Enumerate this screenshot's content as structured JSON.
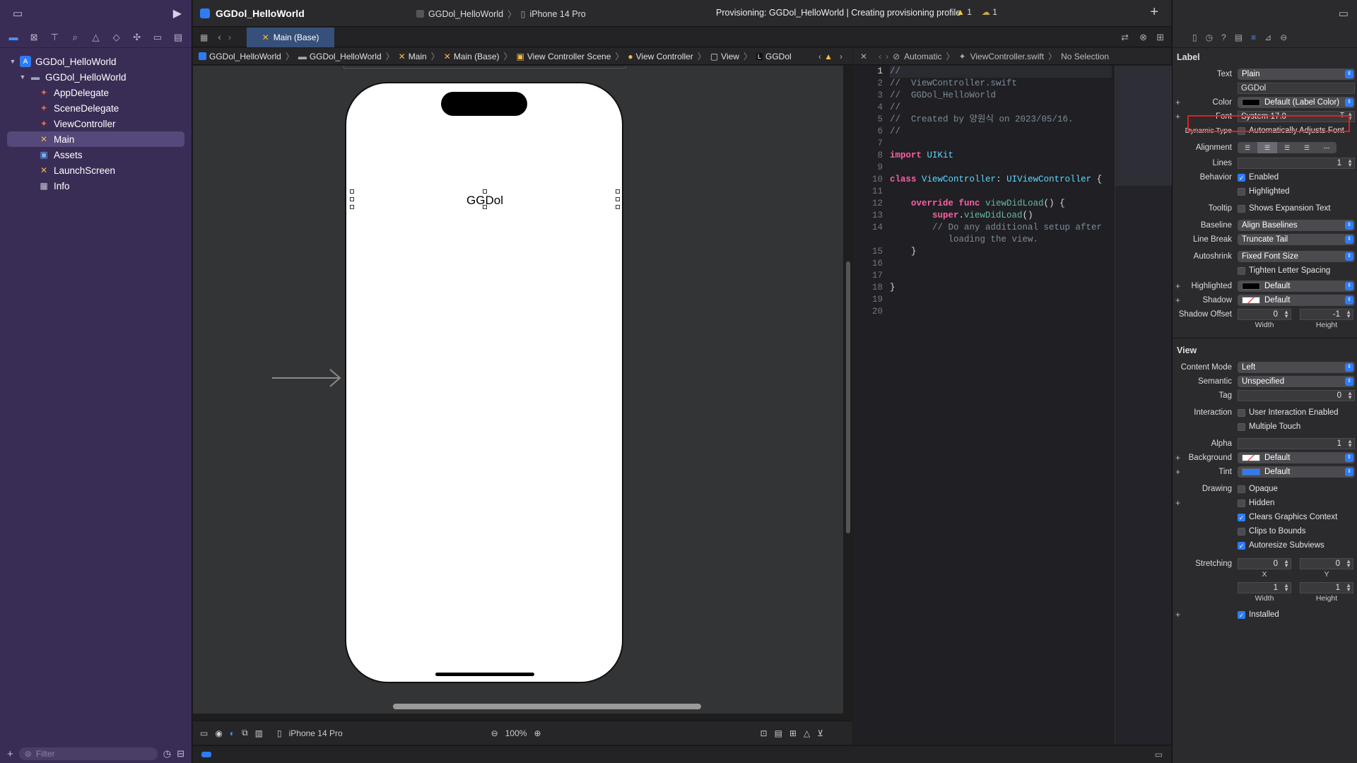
{
  "navigator": {
    "filter_placeholder": "Filter",
    "items": [
      {
        "label": "GGDol_HelloWorld",
        "level": 0,
        "icon": "app-project-icon"
      },
      {
        "label": "GGDol_HelloWorld",
        "level": 1,
        "icon": "folder-icon"
      },
      {
        "label": "AppDelegate",
        "level": 2,
        "icon": "swift-file-icon"
      },
      {
        "label": "SceneDelegate",
        "level": 2,
        "icon": "swift-file-icon"
      },
      {
        "label": "ViewController",
        "level": 2,
        "icon": "swift-file-icon"
      },
      {
        "label": "Main",
        "level": 2,
        "icon": "storyboard-icon"
      },
      {
        "label": "Assets",
        "level": 2,
        "icon": "assets-icon"
      },
      {
        "label": "LaunchScreen",
        "level": 2,
        "icon": "storyboard-icon"
      },
      {
        "label": "Info",
        "level": 2,
        "icon": "plist-icon"
      }
    ]
  },
  "toolbar": {
    "project_title": "GGDol_HelloWorld",
    "scheme": "GGDol_HelloWorld",
    "device": "iPhone 14 Pro",
    "status": "Provisioning: GGDol_HelloWorld | Creating provisioning profile",
    "warnings": "1",
    "issues": "1"
  },
  "tab": {
    "label": "Main (Base)"
  },
  "jumpbar": {
    "items": [
      "GGDol_HelloWorld",
      "GGDol_HelloWorld",
      "Main",
      "Main (Base)",
      "View Controller Scene",
      "View Controller",
      "View",
      "GGDol"
    ]
  },
  "jumpbar2": {
    "mode": "Automatic",
    "file": "ViewController.swift",
    "selection": "No Selection"
  },
  "canvas": {
    "label_text": "GGDol",
    "device": "iPhone 14 Pro",
    "zoom": "100%"
  },
  "code": {
    "line_numbers": [
      "1",
      "2",
      "3",
      "4",
      "5",
      "6",
      "7",
      "8",
      "9",
      "10",
      "11",
      "12",
      "13",
      "14",
      "",
      "15",
      "16",
      "17",
      "18",
      "19",
      "20"
    ],
    "lines": [
      "//",
      "//  ViewController.swift",
      "//  GGDol_HelloWorld",
      "//",
      "//  Created by 양원식 on 2023/05/16.",
      "//",
      "",
      "import UIKit",
      "",
      "class ViewController: UIViewController {",
      "",
      "    override func viewDidLoad() {",
      "        super.viewDidLoad()",
      "        // Do any additional setup after",
      "           loading the view.",
      "    }",
      "",
      "",
      "}",
      "",
      ""
    ]
  },
  "inspector": {
    "label_section": "Label",
    "text_label": "Text",
    "text_value": "Plain",
    "text_content": "GGDol",
    "color_label": "Color",
    "color_value": "Default (Label Color)",
    "font_label": "Font",
    "font_value": "System 17.0",
    "dynamic_label": "Dynamic Type",
    "dynamic_value": "Automatically Adjusts Font",
    "alignment_label": "Alignment",
    "lines_label": "Lines",
    "lines_value": "1",
    "behavior_label": "Behavior",
    "enabled": "Enabled",
    "highlighted": "Highlighted",
    "tooltip_label": "Tooltip",
    "tooltip_value": "Shows Expansion Text",
    "baseline_label": "Baseline",
    "baseline_value": "Align Baselines",
    "linebreak_label": "Line Break",
    "linebreak_value": "Truncate Tail",
    "autoshrink_label": "Autoshrink",
    "autoshrink_value": "Fixed Font Size",
    "tighten": "Tighten Letter Spacing",
    "highlighted_label": "Highlighted",
    "highlighted_value": "Default",
    "shadow_label": "Shadow",
    "shadow_value": "Default",
    "shadow_offset_label": "Shadow Offset",
    "shadow_w": "0",
    "shadow_h": "-1",
    "width": "Width",
    "height": "Height",
    "view_section": "View",
    "content_mode_label": "Content Mode",
    "content_mode_value": "Left",
    "semantic_label": "Semantic",
    "semantic_value": "Unspecified",
    "tag_label": "Tag",
    "tag_value": "0",
    "interaction_label": "Interaction",
    "user_interaction": "User Interaction Enabled",
    "multiple_touch": "Multiple Touch",
    "alpha_label": "Alpha",
    "alpha_value": "1",
    "background_label": "Background",
    "background_value": "Default",
    "tint_label": "Tint",
    "tint_value": "Default",
    "drawing_label": "Drawing",
    "opaque": "Opaque",
    "hidden": "Hidden",
    "clears": "Clears Graphics Context",
    "clips": "Clips to Bounds",
    "autoresize": "Autoresize Subviews",
    "stretching_label": "Stretching",
    "stretch_x": "0",
    "stretch_y": "0",
    "x": "X",
    "y": "Y",
    "stretch_w": "1",
    "stretch_h": "1",
    "installed": "Installed"
  },
  "colors": {
    "accent": "#2f7bf5",
    "navigator_bg": "#3a2d55",
    "highlight_box": "#e02020"
  }
}
